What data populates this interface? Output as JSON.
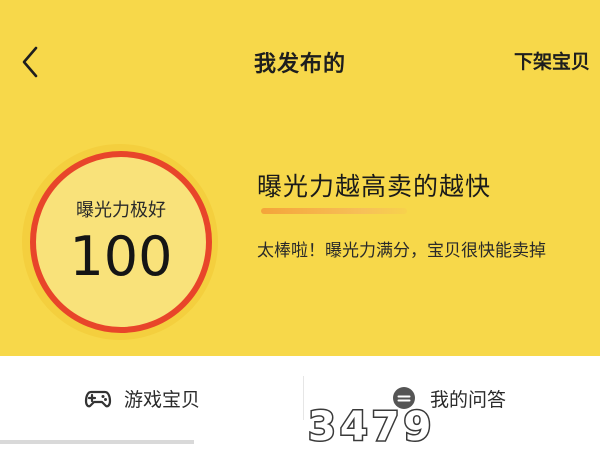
{
  "nav": {
    "back_icon": "chevron-left-icon",
    "title": "我发布的",
    "action_label": "下架宝贝"
  },
  "score": {
    "label": "曝光力极好",
    "value": "100"
  },
  "headline": "曝光力越高卖的越快",
  "description": "太棒啦！曝光力满分，宝贝很快能卖掉",
  "tabs": [
    {
      "label": "游戏宝贝",
      "icon": "gamepad-icon"
    },
    {
      "label": "我的问答",
      "icon": "qa-bubble-icon"
    }
  ],
  "watermark": "3479",
  "colors": {
    "hero_bg": "#f7d84a",
    "ring": "#e8452a",
    "underline": "#f4a43a"
  }
}
